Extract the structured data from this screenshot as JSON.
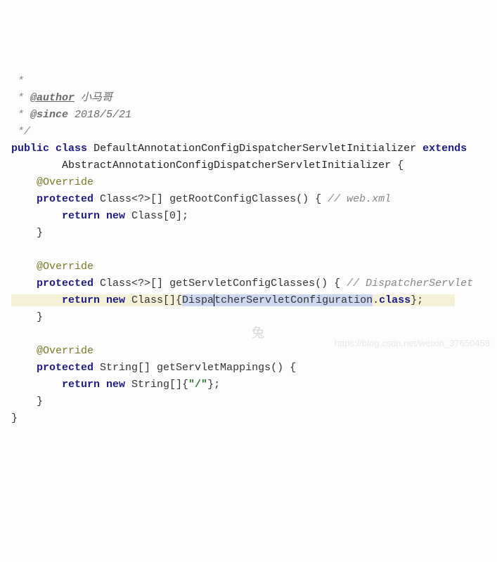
{
  "javadoc": {
    "star": " *",
    "author_tag": "@author",
    "author_name": " 小马哥",
    "since_tag": "@since",
    "since_val": " 2018/5/21",
    "close": " */"
  },
  "decl": {
    "public": "public",
    "class_kw": "class",
    "name": "DefaultAnnotationConfigDispatcherServletInitializer",
    "extends": "extends",
    "parent": "AbstractAnnotationConfigDispatcherServletInitializer",
    "brace": " {"
  },
  "m1": {
    "override": "@Override",
    "sig_pre": "protected",
    "sig_type": " Class<?>[] ",
    "sig_name": "getRootConfigClasses",
    "sig_post": "() { ",
    "comment": "// web.xml",
    "ret_kw": "return new",
    "ret_body": " Class[0];",
    "close": "}"
  },
  "m2": {
    "override": "@Override",
    "sig_pre": "protected",
    "sig_type": " Class<?>[] ",
    "sig_name": "getServletConfigClasses",
    "sig_post": "() { ",
    "comment": "// DispatcherServlet",
    "ret_kw": "return new",
    "ret_body1": " Class[]{",
    "ret_sel1": "Dispa",
    "ret_sel2": "tcherServletConfiguration",
    "ret_dot": ".",
    "ret_kw2": "class",
    "ret_body3": "};",
    "close": "}"
  },
  "m3": {
    "override": "@Override",
    "sig_pre": "protected",
    "sig_type": " String[] ",
    "sig_name": "getServletMappings",
    "sig_post": "() {",
    "ret_kw": "return new",
    "ret_body": " String[]{",
    "ret_str": "\"/\"",
    "ret_body2": "};",
    "close": "}"
  },
  "class_close": "}",
  "watermark1": "兔",
  "watermark2": "https://blog.csdn.net/weixin_37650458"
}
